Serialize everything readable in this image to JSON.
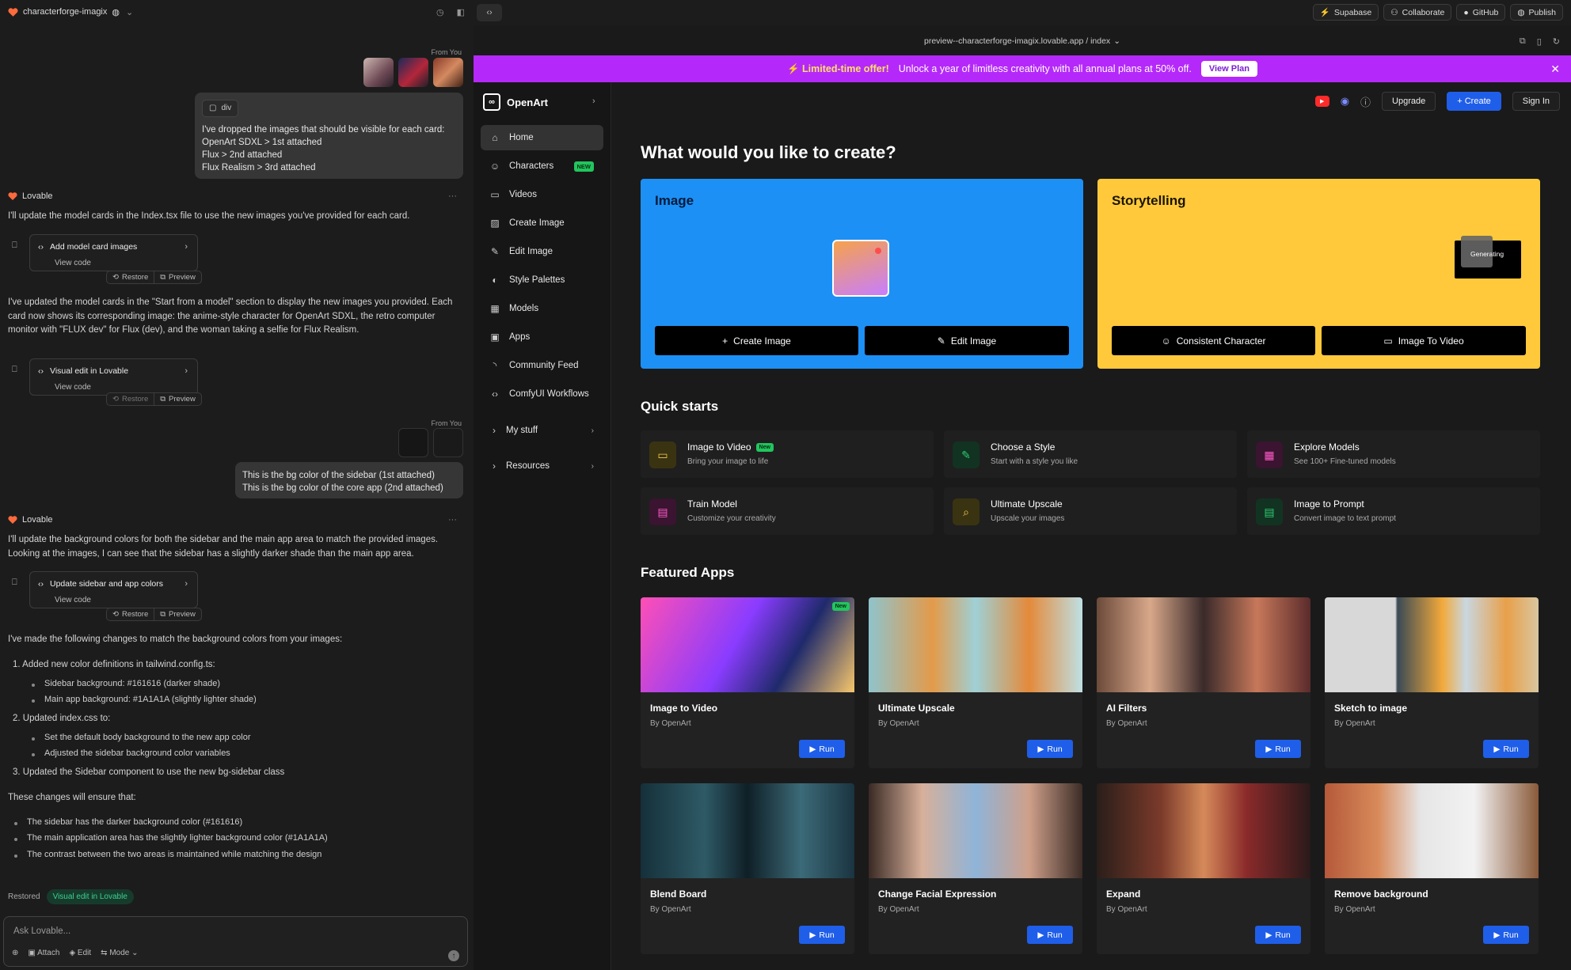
{
  "chat": {
    "project_name": "characterforge-imagix",
    "from_you_label": "From You",
    "msg1": {
      "tag": "div",
      "lines": [
        "I've dropped the images that should be visible for each card:",
        "OpenArt SDXL > 1st attached",
        "Flux > 2nd attached",
        "Flux Realism > 3rd attached"
      ]
    },
    "author": "Lovable",
    "reply1": "I'll update the model cards in the Index.tsx file to use the new images you've provided for each card.",
    "card1": {
      "title": "Add model card images",
      "view": "View code"
    },
    "restore": "Restore",
    "preview": "Preview",
    "reply2": "I've updated the model cards in the \"Start from a model\" section to display the new images you provided. Each card now shows its corresponding image: the anime-style character for OpenArt SDXL, the retro computer monitor with \"FLUX dev\" for Flux (dev), and the woman taking a selfie for Flux Realism.",
    "card2": {
      "title": "Visual edit in Lovable",
      "view": "View code"
    },
    "msg2": {
      "lines": [
        "This is the bg color of the sidebar (1st attached)",
        "This is the bg color of the core app (2nd attached)"
      ]
    },
    "reply3": "I'll update the background colors for both the sidebar and the main app area to match the provided images. Looking at the images, I can see that the sidebar has a slightly darker shade than the main app area.",
    "card3": {
      "title": "Update sidebar and app colors",
      "view": "View code"
    },
    "reply4_intro": "I've made the following changes to match the background colors from your images:",
    "step1": "1.  Added new color definitions in tailwind.config.ts:",
    "step1_b1": "Sidebar background: #161616 (darker shade)",
    "step1_b2": "Main app background: #1A1A1A (slightly lighter shade)",
    "step2": "2.  Updated index.css to:",
    "step2_b1": "Set the default body background to the new app color",
    "step2_b2": "Adjusted the sidebar background color variables",
    "step3": "3.  Updated the Sidebar component to use the new bg-sidebar class",
    "ensure": "These changes will ensure that:",
    "ensure_b1": "The sidebar has the darker background color (#161616)",
    "ensure_b2": "The main application area has the slightly lighter background color (#1A1A1A)",
    "ensure_b3": "The contrast between the two areas is maintained while matching the design",
    "restored_label": "Restored",
    "restored_chip": "Visual edit in Lovable",
    "input_placeholder": "Ask Lovable...",
    "tool_attach": "Attach",
    "tool_edit": "Edit",
    "tool_mode": "Mode"
  },
  "topbar": {
    "supabase": "Supabase",
    "collaborate": "Collaborate",
    "github": "GitHub",
    "publish": "Publish",
    "url": "preview--characterforge-imagix.lovable.app / index"
  },
  "promo": {
    "lead": "⚡ Limited-time offer!",
    "text": "Unlock a year of limitless creativity with all annual plans at 50% off.",
    "button": "View Plan"
  },
  "sidebar": {
    "brand": "OpenArt",
    "items": [
      {
        "label": "Home"
      },
      {
        "label": "Characters",
        "badge": "NEW"
      },
      {
        "label": "Videos"
      },
      {
        "label": "Create Image"
      },
      {
        "label": "Edit Image"
      },
      {
        "label": "Style Palettes"
      },
      {
        "label": "Models"
      },
      {
        "label": "Apps"
      },
      {
        "label": "Community Feed"
      },
      {
        "label": "ComfyUI Workflows"
      }
    ],
    "my_stuff": "My stuff",
    "resources": "Resources"
  },
  "header": {
    "upgrade": "Upgrade",
    "create": "+ Create",
    "signin": "Sign In"
  },
  "main": {
    "title": "What would you like to create?",
    "image_card": {
      "title": "Image",
      "btn1": "Create Image",
      "btn2": "Edit Image"
    },
    "story_card": {
      "title": "Storytelling",
      "generating": "Generating",
      "btn1": "Consistent Character",
      "btn2": "Image To Video"
    },
    "quick_title": "Quick starts",
    "quick": [
      {
        "title": "Image to Video",
        "desc": "Bring your image to life",
        "badge": "New"
      },
      {
        "title": "Choose a Style",
        "desc": "Start with a style you like"
      },
      {
        "title": "Explore Models",
        "desc": "See 100+ Fine-tuned models"
      },
      {
        "title": "Train Model",
        "desc": "Customize your creativity"
      },
      {
        "title": "Ultimate Upscale",
        "desc": "Upscale your images"
      },
      {
        "title": "Image to Prompt",
        "desc": "Convert image to text prompt"
      }
    ],
    "featured_title": "Featured Apps",
    "apps": [
      {
        "name": "Image to Video",
        "by": "By OpenArt",
        "badge": "New"
      },
      {
        "name": "Ultimate Upscale",
        "by": "By OpenArt"
      },
      {
        "name": "AI Filters",
        "by": "By OpenArt"
      },
      {
        "name": "Sketch to image",
        "by": "By OpenArt"
      },
      {
        "name": "Blend Board",
        "by": "By OpenArt"
      },
      {
        "name": "Change Facial Expression",
        "by": "By OpenArt"
      },
      {
        "name": "Expand",
        "by": "By OpenArt"
      },
      {
        "name": "Remove background",
        "by": "By OpenArt"
      }
    ],
    "run": "Run"
  }
}
